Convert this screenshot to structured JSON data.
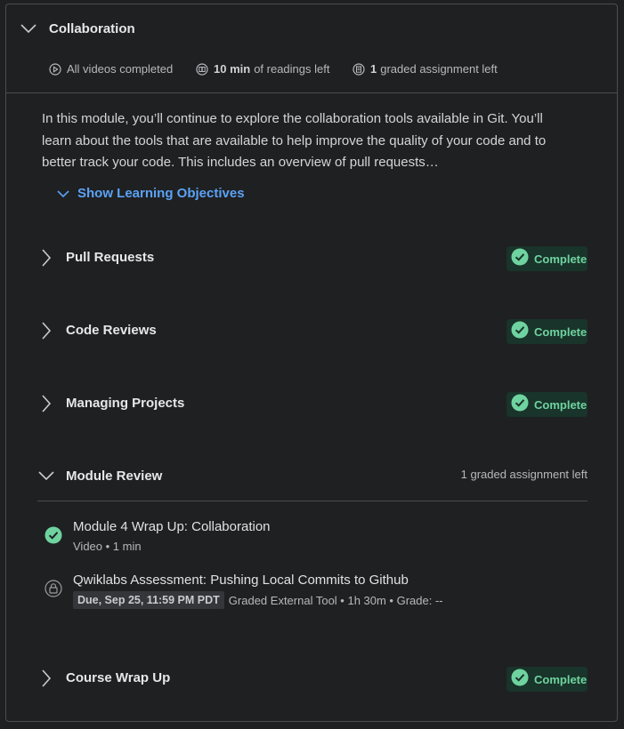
{
  "module": {
    "title": "Collaboration",
    "meta": {
      "videos": "All videos completed",
      "readings_bold": "10 min",
      "readings_rest": "of readings left",
      "graded_bold": "1",
      "graded_rest": "graded assignment left"
    },
    "description": "In this module, you’ll continue to explore the collaboration tools available in Git. You’ll learn about the tools that are available to help improve the quality of your code and to better track your code. This includes an overview of pull requests…",
    "show_objectives": "Show Learning Objectives"
  },
  "lessons": [
    {
      "title": "Pull Requests",
      "status": "Complete"
    },
    {
      "title": "Code Reviews",
      "status": "Complete"
    },
    {
      "title": "Managing Projects",
      "status": "Complete"
    }
  ],
  "review": {
    "title": "Module Review",
    "summary": "1 graded assignment left",
    "items": [
      {
        "title": "Module 4 Wrap Up: Collaboration",
        "meta": "Video • 1 min",
        "icon": "check-circle-icon"
      },
      {
        "title": "Qwiklabs Assessment: Pushing Local Commits to Github",
        "due": "Due, Sep 25, 11:59 PM PDT",
        "meta": "Graded External Tool • 1h 30m • Grade: --",
        "icon": "lock-icon"
      }
    ]
  },
  "wrap_up": {
    "title": "Course Wrap Up",
    "status": "Complete"
  },
  "colors": {
    "accent": "#5aa2f5",
    "complete": "#6fd3a0",
    "complete_bg": "#19342a"
  }
}
